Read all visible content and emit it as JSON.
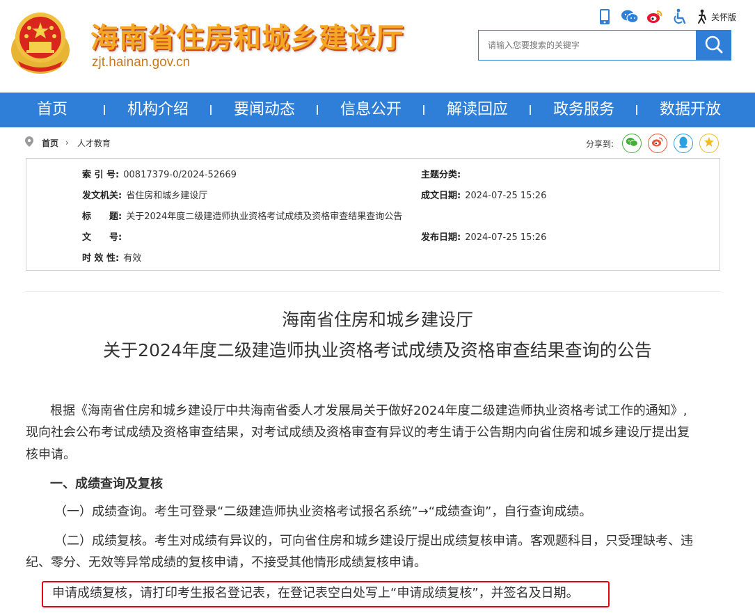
{
  "header": {
    "site_title": "海南省住房和城乡建设厅",
    "site_url": "zjt.hainan.gov.cn",
    "care_label": "关怀版",
    "tool_icons": [
      "mobile-icon",
      "wechat-icon",
      "weibo-icon",
      "accessibility-icon",
      "elderly-care-icon"
    ],
    "search_placeholder": "请输入您要搜索的关键字"
  },
  "nav": {
    "items": [
      "首页",
      "机构介绍",
      "要闻动态",
      "信息公开",
      "解读回应",
      "政务服务",
      "数据开放"
    ]
  },
  "breadcrumb": {
    "home": "首页",
    "arrow": "›",
    "current": "人才教育"
  },
  "share": {
    "label": "分享到:",
    "targets": [
      "wechat-icon",
      "weibo-icon",
      "qq-icon",
      "qzone-icon"
    ]
  },
  "info": {
    "index_label": "索 引 号:",
    "index_value": "00817379-0/2024-52669",
    "topic_label": "主题分类:",
    "topic_value": "",
    "issuer_label": "发文机关:",
    "issuer_value": "省住房和城乡建设厅",
    "created_label": "成文日期:",
    "created_value": "2024-07-25 15:26",
    "title_label": "标　　题:",
    "title_value": "关于2024年度二级建造师执业资格考试成绩及资格审查结果查询公告",
    "docno_label": "文　　号:",
    "docno_value": "",
    "published_label": "发布日期:",
    "published_value": "2024-07-25 15:26",
    "validity_label": "时 效 性:",
    "validity_value": "有效"
  },
  "article": {
    "title_line1": "海南省住房和城乡建设厅",
    "title_line2": "关于2024年度二级建造师执业资格考试成绩及资格审查结果查询的公告",
    "para1_line1": "根据《海南省住房和城乡建设厅中共海南省委人才发展局关于做好2024年度二级建造师执业资格考试工作的通知》,",
    "para1_line2": "现向社会公布考试成绩及资格审查结果，对考试成绩及资格审查有异议的考生请于公告期内向省住房和城乡建设厅提出复",
    "para1_line3": "核申请。",
    "section1": "一、成绩查询及复核",
    "item1": "（一）成绩查询。考生可登录“二级建造师执业资格考试报名系统”→“成绩查询”，自行查询成绩。",
    "item2_line1": "（二）成绩复核。考生对成绩有异议的，可向省住房和城乡建设厅提出成绩复核申请。客观题科目，只受理缺考、违",
    "item2_line2": "纪、零分、无效等异常成绩的复核申请，不接受其他情形成绩复核申请。",
    "highlight": "申请成绩复核，请打印考生报名登记表，在登记表空白处写上“申请成绩复核”，并签名及日期。"
  },
  "colors": {
    "nav_blue": "#2f7fd8",
    "title_orange": "#f5a623",
    "highlight_red": "#e60012"
  }
}
